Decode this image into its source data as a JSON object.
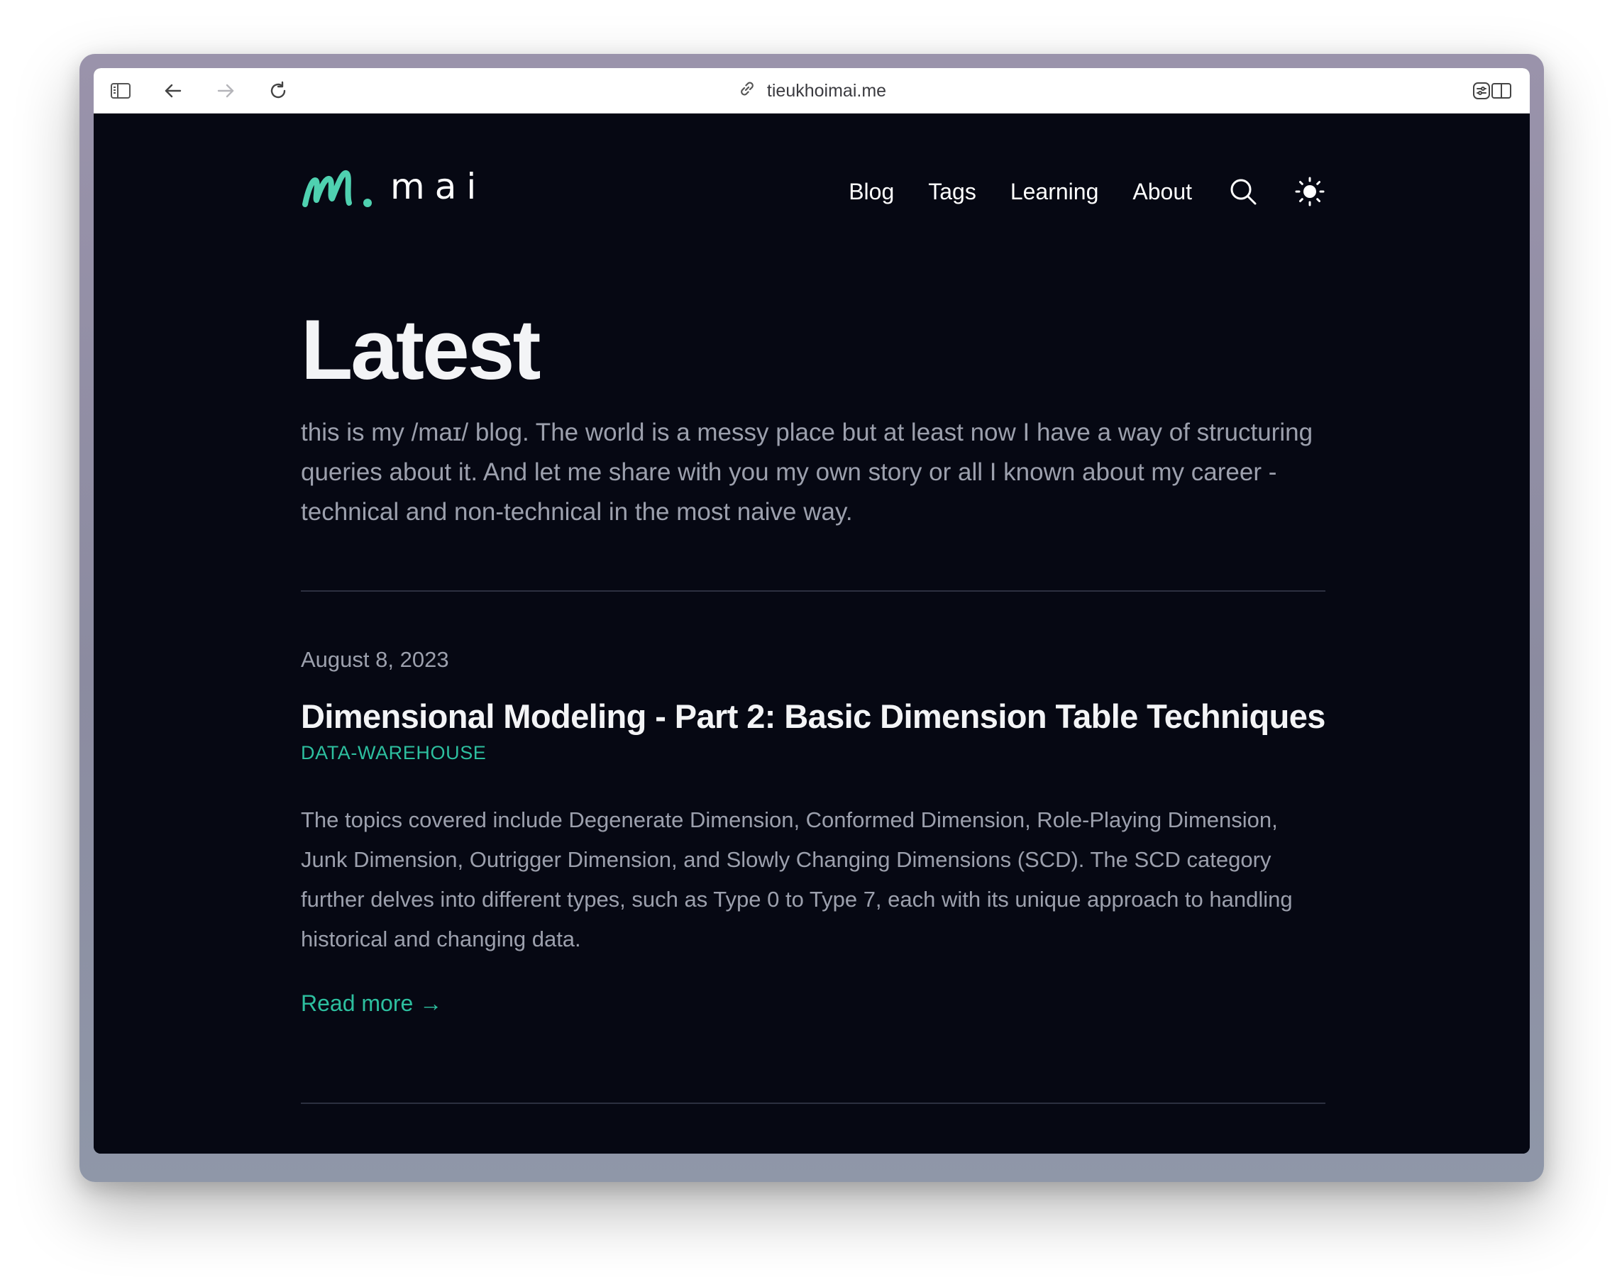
{
  "browser": {
    "url": "tieukhoimai.me",
    "icons": [
      "sidebar-icon",
      "back-arrow-icon",
      "forward-arrow-icon",
      "reload-icon",
      "link-icon",
      "extensions-icon",
      "split-view-icon"
    ]
  },
  "site": {
    "logo_text": "mai",
    "nav": {
      "blog": "Blog",
      "tags": "Tags",
      "learning": "Learning",
      "about": "About"
    },
    "icons": [
      "search-icon",
      "sun-icon"
    ]
  },
  "main": {
    "title": "Latest",
    "intro": "this is my /maɪ/ blog. The world is a messy place but at least now I have a way of structuring queries about it. And let me share with you my own story or all I known about my career - technical and non-technical in the most naive way."
  },
  "posts": [
    {
      "date": "August 8, 2023",
      "title": "Dimensional Modeling - Part 2: Basic Dimension Table Techniques",
      "tag": "DATA-WAREHOUSE",
      "summary": "The topics covered include Degenerate Dimension, Conformed Dimension, Role-Playing Dimension, Junk Dimension, Outrigger Dimension, and Slowly Changing Dimensions (SCD). The SCD category further delves into different types, such as Type 0 to Type 7, each with its unique approach to handling historical and changing data.",
      "read_more": "Read more →"
    }
  ],
  "colors": {
    "page_bg": "#060813",
    "accent": "#2dbf9f",
    "text_primary": "#f3f4f6",
    "text_muted": "#9ca0ad"
  }
}
